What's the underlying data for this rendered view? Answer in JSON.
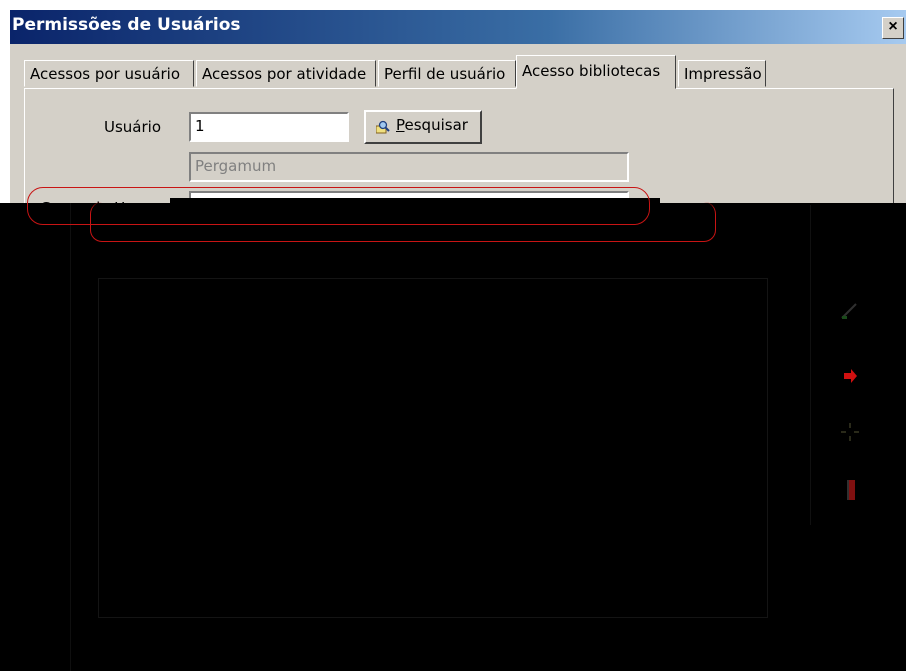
{
  "window": {
    "title": "Permissões de Usuários",
    "close_glyph": "×"
  },
  "tabs": [
    {
      "label": "Acessos por usuário",
      "active": false
    },
    {
      "label": "Acessos por atividade",
      "active": false
    },
    {
      "label": "Perfil de usuário",
      "active": false
    },
    {
      "label": "Acesso bibliotecas",
      "active": true
    },
    {
      "label": "Impressão",
      "active": false
    }
  ],
  "form": {
    "usuario_label": "Usuário",
    "usuario_value": "1",
    "search_button_label": "Pesquisar",
    "nome_value": "Pergamum",
    "grupo_label": "Grupo de Us"
  },
  "icons": {
    "search": "magnifier-icon",
    "side": [
      "pencil-icon",
      "red-arrow-icon",
      "sparkle-icon",
      "book-icon"
    ]
  },
  "colors": {
    "titlebar_start": "#0a246a",
    "titlebar_end": "#a6caf0",
    "window_face": "#d4d0c8",
    "annotation": "#c81414"
  }
}
